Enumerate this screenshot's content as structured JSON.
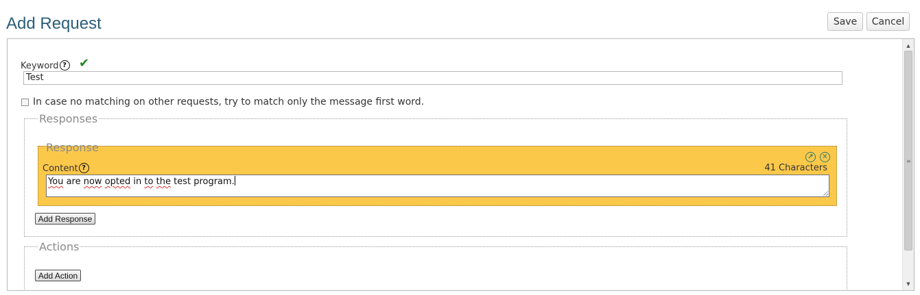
{
  "header": {
    "title": "Add Request",
    "save_label": "Save",
    "cancel_label": "Cancel"
  },
  "keyword": {
    "label": "Keyword",
    "value": "Test",
    "help_glyph": "?"
  },
  "first_word_option": {
    "label": "In case no matching on other requests, try to match only the message first word.",
    "checked": false
  },
  "responses": {
    "legend": "Responses",
    "items": [
      {
        "legend": "Response",
        "content_label": "Content",
        "char_count": "41 Characters",
        "words": [
          "You",
          "are",
          "now",
          "opted",
          "in",
          "to",
          "the",
          "test program."
        ]
      }
    ],
    "add_label": "Add Response"
  },
  "actions": {
    "legend": "Actions",
    "add_label": "Add Action"
  },
  "colors": {
    "title": "#2b5e78",
    "response_bg": "#fcc84a",
    "check": "#1f8a1f"
  }
}
